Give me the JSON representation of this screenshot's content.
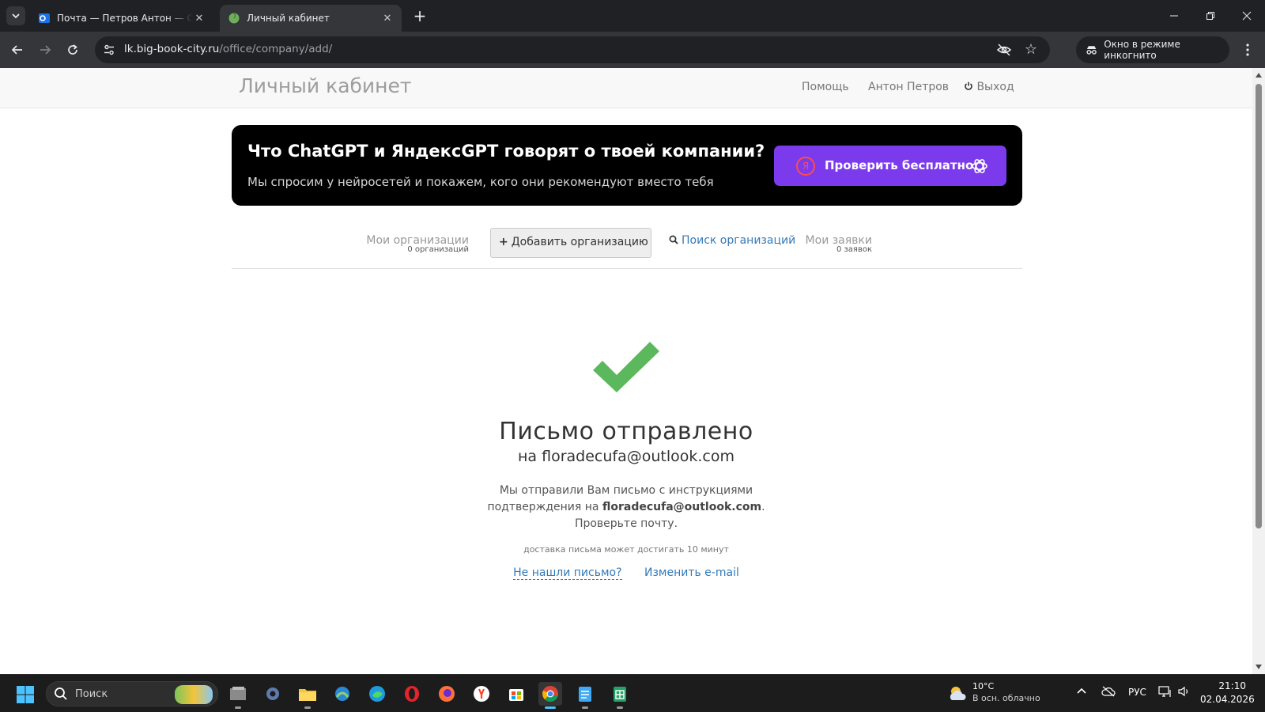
{
  "browser": {
    "tabs": [
      {
        "title": "Почта — Петров Антон — Outlook",
        "active": false
      },
      {
        "title": "Личный кабинет",
        "active": true
      }
    ],
    "url_host": "lk.big-book-city.ru",
    "url_path": "/office/company/add/",
    "incognito_label": "Окно в режиме инкогнито"
  },
  "header": {
    "brand": "Личный кабинет",
    "nav": {
      "help": "Помощь",
      "user": "Антон Петров",
      "logout": "Выход"
    }
  },
  "promo": {
    "title": "Что ChatGPT и ЯндексGPT говорят о твоей компании?",
    "subtitle": "Мы спросим у нейросетей и покажем, кого они рекомендуют вместо тебя",
    "button": "Проверить бесплатно",
    "ya_letter": "Я",
    "bg_color": "#000000",
    "button_color": "#7c3aed"
  },
  "org_tabs": {
    "my_orgs": {
      "label": "Мои организации",
      "count": "0 организаций"
    },
    "add_org": {
      "label": "Добавить организацию"
    },
    "search_orgs": {
      "label": "Поиск организаций"
    },
    "my_requests": {
      "label": "Мои заявки",
      "count": "0 заявок"
    }
  },
  "success": {
    "title": "Письмо отправлено",
    "email_line": "на floradecufa@outlook.com",
    "text_before": "Мы отправили Вам письмо с инструкциями подтверждения на ",
    "email": "floradecufa@outlook.com",
    "text_after": ". Проверьте почту.",
    "note": "доставка письма может достигать 10 минут",
    "link_not_found": "Не нашли письмо?",
    "link_change": "Изменить e-mail",
    "check_color": "#5cb85c"
  },
  "taskbar": {
    "search_placeholder": "Поиск",
    "apps": [
      "file-explorer-alt",
      "settings",
      "file-explorer",
      "photos",
      "edge",
      "opera",
      "firefox",
      "yandex-browser",
      "store",
      "chrome",
      "notepad",
      "spreadsheet"
    ],
    "weather_temp": "10°C",
    "weather_desc": "В осн. облачно",
    "lang": "РУС",
    "time": "21:10",
    "date": "02.04.2026"
  }
}
